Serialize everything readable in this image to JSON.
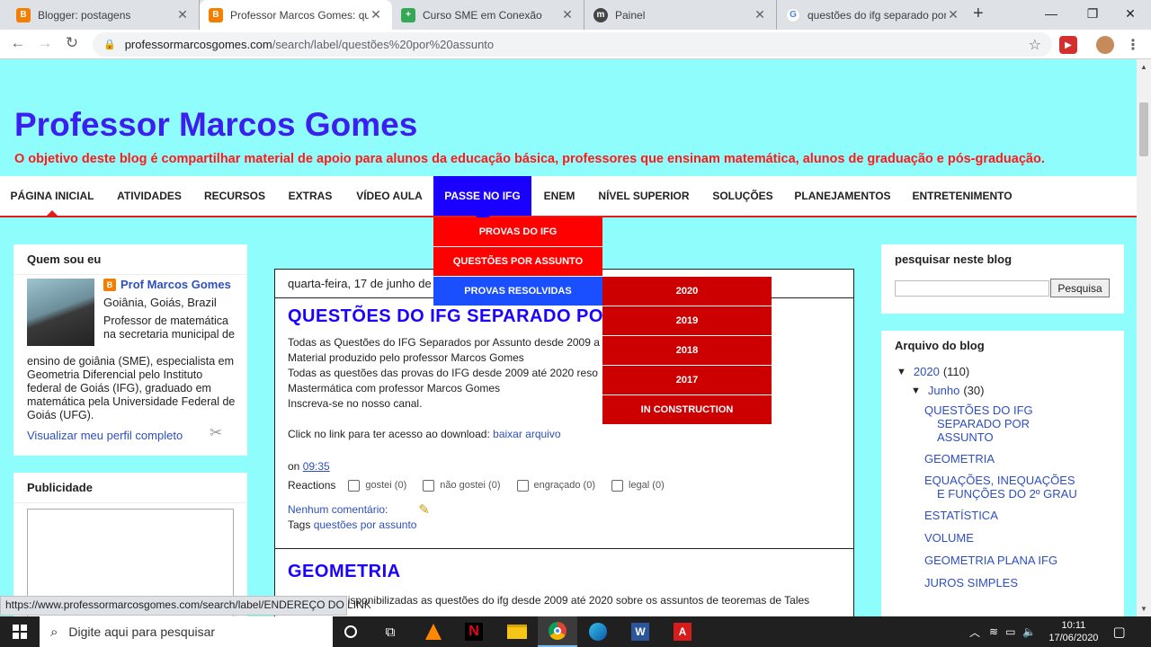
{
  "browser": {
    "tabs": [
      {
        "title": "Blogger: postagens",
        "icon": "B",
        "color": "#f57d00"
      },
      {
        "title": "Professor Marcos Gomes: ques",
        "icon": "B",
        "color": "#f57d00"
      },
      {
        "title": "Curso SME em Conexão",
        "icon": "+",
        "color": "#34a853"
      },
      {
        "title": "Painel",
        "icon": "m",
        "color": "#444444"
      },
      {
        "title": "questões do ifg separado por a",
        "icon": "G",
        "color": "#4285f4"
      }
    ],
    "url_host": "professormarcosgomes.com",
    "url_path": "/search/label/questões%20por%20assunto",
    "status_url": "https://www.professormarcosgomes.com/search/label/ENDEREÇO DO LINK"
  },
  "blog": {
    "title": "Professor Marcos Gomes",
    "description": "O objetivo deste blog é compartilhar material de apoio para alunos da educação básica, professores que ensinam matemática, alunos de graduação e pós-graduação."
  },
  "menu": {
    "items": [
      "Página inicial",
      "Atividades",
      "Recursos",
      "Extras",
      "Vídeo aula",
      "Passe no IFG",
      "ENEM",
      "Nível superior",
      "Soluções",
      "Planejamentos",
      "Entretenimento"
    ],
    "submenu": [
      "PROVAS DO IFG",
      "QUESTÕES POR ASSUNTO",
      "PROVAS RESOLVIDAS"
    ],
    "subsubmenu": [
      "2020",
      "2019",
      "2018",
      "2017",
      "IN CONSTRUCTION"
    ]
  },
  "profile": {
    "title": "Quem sou eu",
    "name": "Prof Marcos Gomes",
    "location": "Goiânia, Goiás, Brazil",
    "bio_right": "Professor de matemática na secretaria municipal de",
    "bio_rest": "ensino de goiânia (SME), especialista em Geometria Diferencial pelo Instituto federal de Goiás (IFG), graduado em matemática pela Universidade Federal de Goiás (UFG).",
    "profile_link": "Visualizar meu perfil completo"
  },
  "ads": {
    "title": "Publicidade"
  },
  "post": {
    "date": "quarta-feira, 17 de junho de",
    "title": "QUESTÕES DO IFG SEPARADO PO",
    "lines": [
      "Todas as Questões do IFG Separados por Assunto desde 2009 a",
      "Material produzido pelo professor Marcos Gomes",
      "Todas as questões das provas do IFG desde 2009 até 2020 reso",
      "Mastermática com professor Marcos Gomes",
      "Inscreva-se no nosso canal."
    ],
    "download_text": "Click no link para ter acesso ao download:",
    "download_link": "baixar arquivo",
    "on_label": "on",
    "time": "09:35",
    "reactions_label": "Reactions",
    "reactions": [
      "gostei (0)",
      "não gostei (0)",
      "engraçado (0)",
      "legal (0)"
    ],
    "comments": "Nenhum comentário:",
    "tags_label": "Tags",
    "tag": "questões por assunto",
    "next_title": "GEOMETRIA",
    "next_excerpt": "Aqui estão disponibilizadas as questões do ifg desde 2009 até 2020 sobre os assuntos de teoremas de Tales"
  },
  "search_widget": {
    "title": "pesquisar neste blog",
    "button": "Pesquisa"
  },
  "archive": {
    "title": "Arquivo do blog",
    "year": "2020",
    "year_count": "(110)",
    "month": "Junho",
    "month_count": "(30)",
    "posts": [
      "QUESTÕES DO IFG SEPARADO POR ASSUNTO",
      "GEOMETRIA",
      "EQUAÇÕES, INEQUAÇÕES E FUNÇÕES DO 2º GRAU",
      "ESTATÍSTICA",
      "VOLUME",
      "GEOMETRIA PLANA IFG",
      "JUROS SIMPLES"
    ]
  },
  "taskbar": {
    "search_placeholder": "Digite aqui para pesquisar",
    "time": "10:11",
    "date": "17/06/2020"
  }
}
